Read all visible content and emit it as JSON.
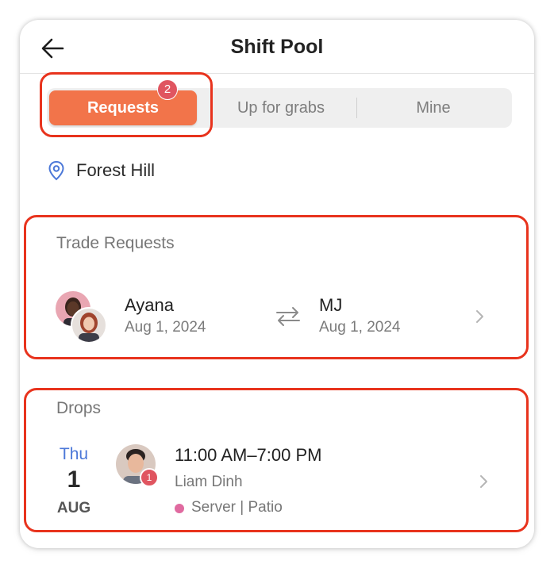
{
  "header": {
    "title": "Shift Pool",
    "back_icon": "arrow-left-icon"
  },
  "tabs": [
    {
      "label": "Requests",
      "selected": true,
      "badge": "2"
    },
    {
      "label": "Up for grabs",
      "selected": false
    },
    {
      "label": "Mine",
      "selected": false
    }
  ],
  "location": {
    "name": "Forest Hill",
    "icon": "location-pin-icon"
  },
  "trade_requests": {
    "title": "Trade Requests",
    "items": [
      {
        "from_name": "Ayana",
        "from_date": "Aug 1, 2024",
        "to_name": "MJ",
        "to_date": "Aug 1, 2024"
      }
    ]
  },
  "drops": {
    "title": "Drops",
    "items": [
      {
        "day_name": "Thu",
        "day_num": "1",
        "month": "AUG",
        "time": "11:00 AM–7:00 PM",
        "worker": "Liam Dinh",
        "badge": "1",
        "role": "Server | Patio"
      }
    ]
  },
  "colors": {
    "accent": "#f2744a",
    "badge": "#e05560",
    "highlight": "#e8331d",
    "day_blue": "#4c78d8",
    "role_dot": "#e06aa0"
  }
}
